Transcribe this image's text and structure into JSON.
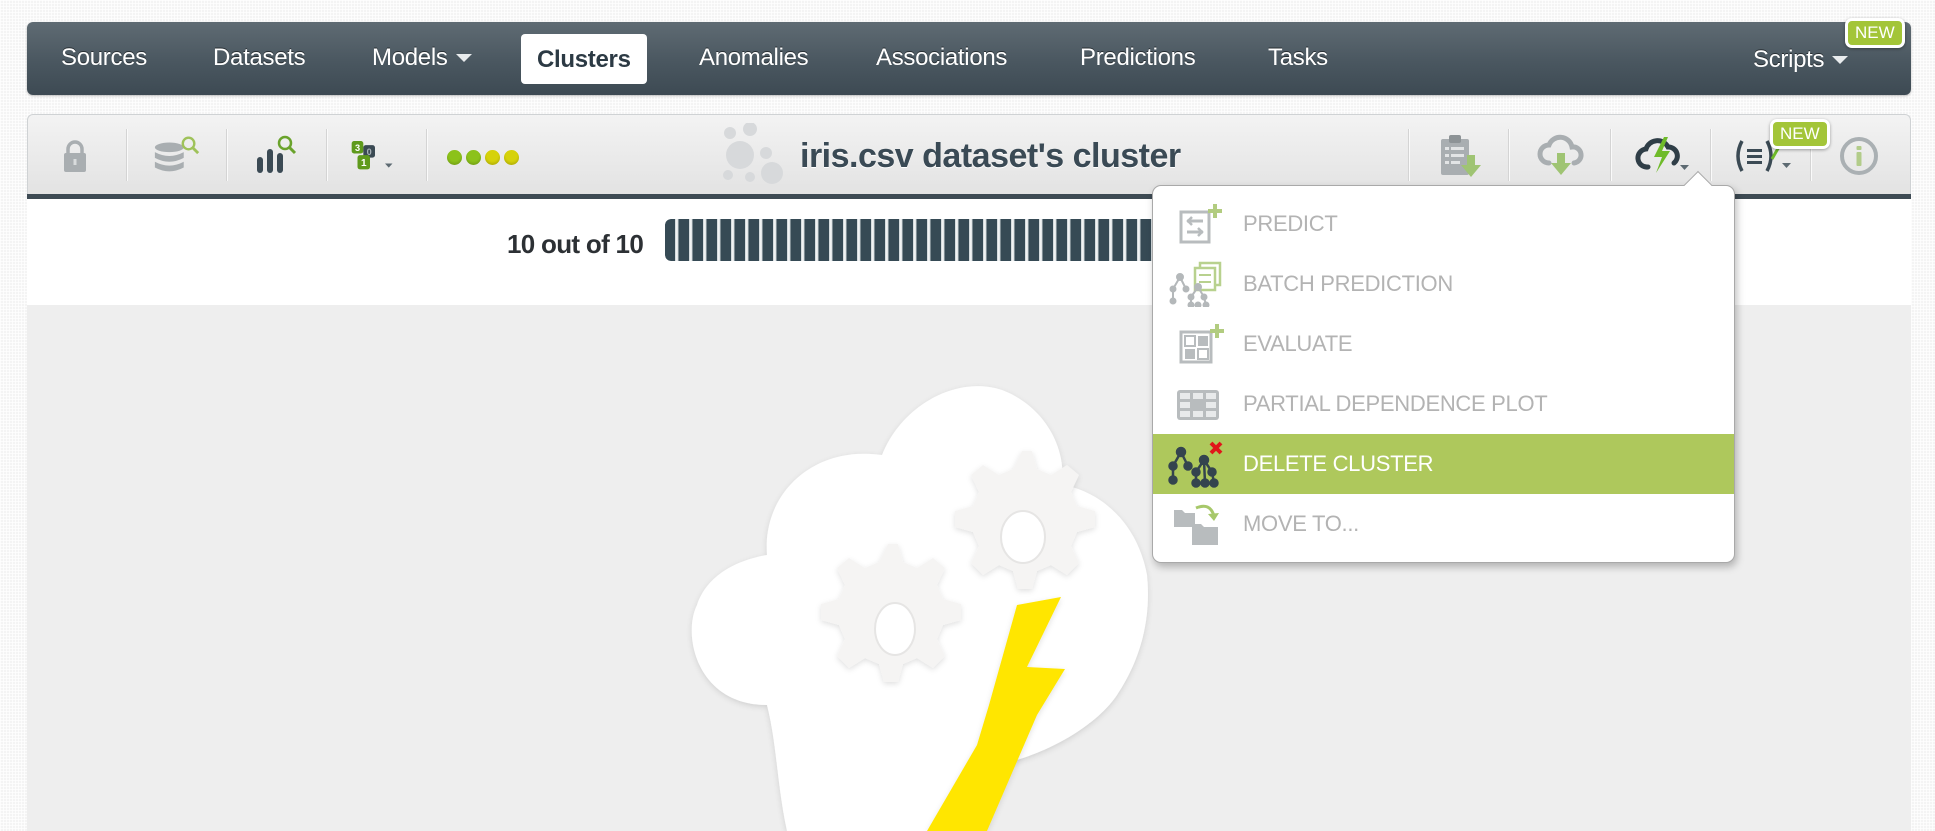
{
  "nav": {
    "items": [
      {
        "label": "Sources",
        "active": false,
        "dropdown": false
      },
      {
        "label": "Datasets",
        "active": false,
        "dropdown": false
      },
      {
        "label": "Models",
        "active": false,
        "dropdown": true
      },
      {
        "label": "Clusters",
        "active": true,
        "dropdown": false
      },
      {
        "label": "Anomalies",
        "active": false,
        "dropdown": false
      },
      {
        "label": "Associations",
        "active": false,
        "dropdown": false
      },
      {
        "label": "Predictions",
        "active": false,
        "dropdown": false
      },
      {
        "label": "Tasks",
        "active": false,
        "dropdown": false
      }
    ],
    "scripts_label": "Scripts",
    "scripts_badge": "NEW"
  },
  "toolbar": {
    "left_icons": [
      "lock-icon",
      "dataset-search-icon",
      "chart-search-icon",
      "sampling-icon"
    ],
    "status_dots": [
      "#8cc21a",
      "#8cc21a",
      "#d6d20a",
      "#d6d20a"
    ],
    "title": "iris.csv dataset's cluster",
    "title_icon": "cluster-icon",
    "right_icons": [
      "clipboard-download-icon",
      "cloud-download-icon",
      "cloud-lightning-icon",
      "whizzml-icon",
      "info-icon"
    ],
    "whizzml_badge": "NEW"
  },
  "progress": {
    "label": "10 out of 10",
    "current": 10,
    "total": 10
  },
  "actions_menu": {
    "items": [
      {
        "label": "PREDICT",
        "icon": "predict-icon",
        "highlighted": false
      },
      {
        "label": "BATCH PREDICTION",
        "icon": "batch-prediction-icon",
        "highlighted": false
      },
      {
        "label": "EVALUATE",
        "icon": "evaluate-icon",
        "highlighted": false
      },
      {
        "label": "PARTIAL DEPENDENCE PLOT",
        "icon": "partial-dependence-icon",
        "highlighted": false
      },
      {
        "label": "DELETE CLUSTER",
        "icon": "delete-cluster-icon",
        "highlighted": true
      },
      {
        "label": "MOVE TO...",
        "icon": "move-to-icon",
        "highlighted": false
      }
    ]
  },
  "colors": {
    "accent_green": "#aec85c",
    "nav_dark": "#3d4a53",
    "badge_green": "#a3c538",
    "lightning_yellow": "#ffe600"
  }
}
